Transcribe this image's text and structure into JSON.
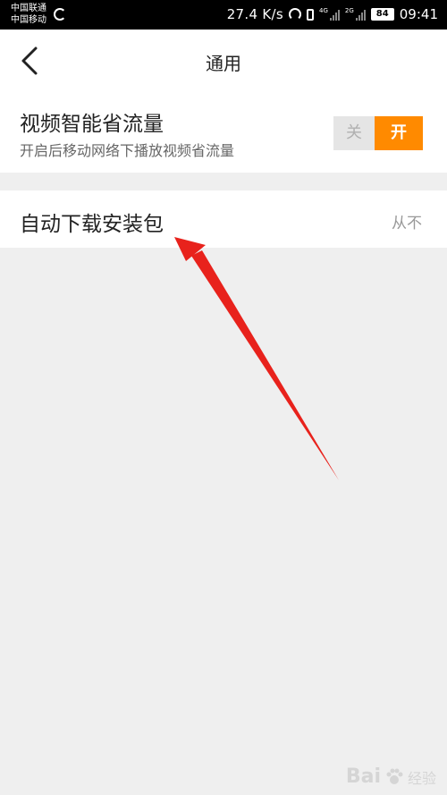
{
  "status_bar": {
    "carrier_1": "中国联通",
    "carrier_2": "中国移动",
    "net_speed": "27.4 K/s",
    "sig1_label": "4G",
    "sig2_label": "2G",
    "battery": "84",
    "time": "09:41"
  },
  "header": {
    "title": "通用",
    "back_icon": "chevron-left-icon"
  },
  "settings": {
    "smart_traffic": {
      "title": "视频智能省流量",
      "description": "开启后移动网络下播放视频省流量",
      "toggle_off_label": "关",
      "toggle_on_label": "开",
      "state": "on"
    },
    "auto_download": {
      "title": "自动下载安装包",
      "value": "从不"
    }
  },
  "colors": {
    "accent": "#ff8a00",
    "arrow": "#e8221c",
    "background": "#efefef"
  },
  "watermark": {
    "brand": "Bai",
    "sub": "经验"
  }
}
